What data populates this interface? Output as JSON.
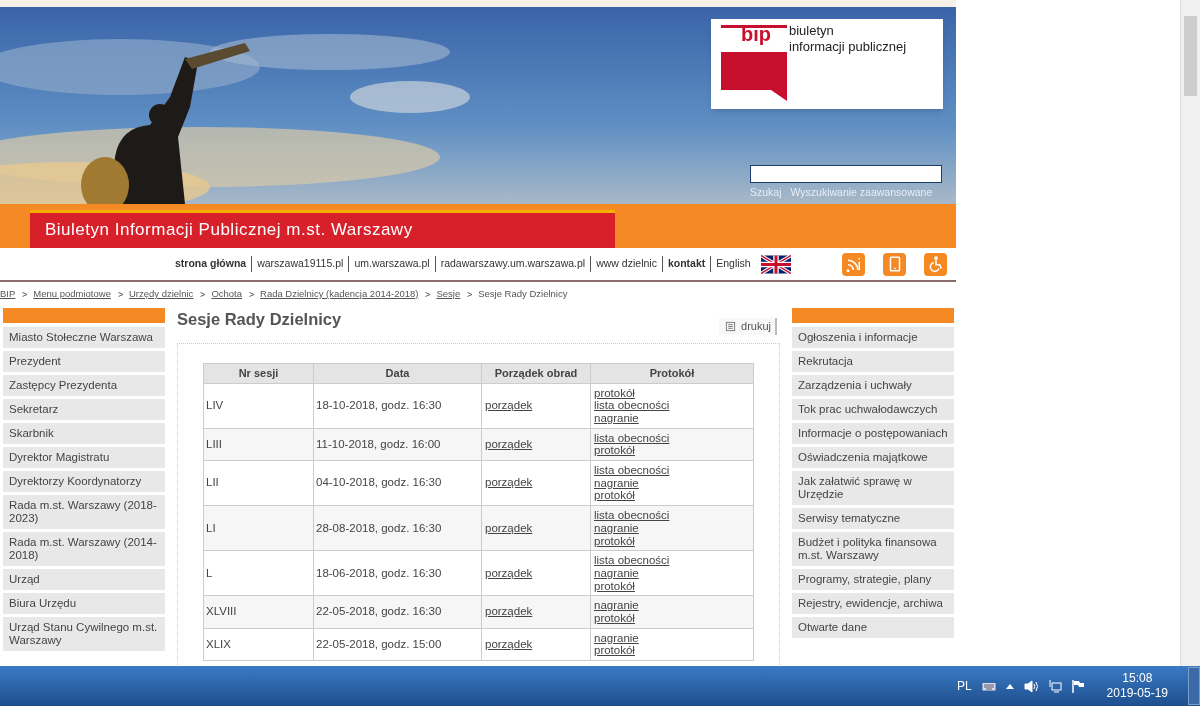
{
  "header": {
    "logo": {
      "mark": "bip",
      "line1": "biuletyn",
      "line2": "informacji publicznej"
    },
    "search": {
      "button": "Szukaj",
      "advanced": "Wyszukiwanie zaawansowane"
    },
    "title": "Biuletyn Informacji Publicznej m.st. Warszawy"
  },
  "nav": {
    "links": [
      {
        "label": "strona główna",
        "bold": true
      },
      {
        "label": "warszawa19115.pl",
        "bold": false
      },
      {
        "label": "um.warszawa.pl",
        "bold": false
      },
      {
        "label": "radawarszawy.um.warszawa.pl",
        "bold": false
      },
      {
        "label": "www dzielnic",
        "bold": false
      },
      {
        "label": "kontakt",
        "bold": true
      }
    ],
    "language": "English"
  },
  "breadcrumb": [
    {
      "label": "BIP",
      "kind": "link"
    },
    {
      "label": "Menu podmiotowe",
      "kind": "link"
    },
    {
      "label": "Urzędy dzielnic",
      "kind": "link"
    },
    {
      "label": "Ochota",
      "kind": "link"
    },
    {
      "label": "Rada Dzielnicy (kadencja 2014-2018)",
      "kind": "link"
    },
    {
      "label": "Sesje",
      "kind": "link"
    },
    {
      "label": "Sesje Rady Dzielnicy",
      "kind": "current"
    }
  ],
  "left_menu": [
    "Miasto Stołeczne Warszawa",
    "Prezydent",
    "Zastępcy Prezydenta",
    "Sekretarz",
    "Skarbnik",
    "Dyrektor Magistratu",
    "Dyrektorzy Koordynatorzy",
    "Rada m.st. Warszawy (2018-2023)",
    "Rada m.st. Warszawy (2014-2018)",
    "Urząd",
    "Biura Urzędu",
    "Urząd Stanu Cywilnego m.st. Warszawy"
  ],
  "page": {
    "title": "Sesje Rady Dzielnicy",
    "print": "drukuj"
  },
  "table": {
    "columns": [
      "Nr sesji",
      "Data",
      "Porządek obrad",
      "Protokół"
    ],
    "rows": [
      {
        "nr": "LIV",
        "date": "18-10-2018, godz. 16:30",
        "agenda": "porządek",
        "protocol": [
          "protokół",
          "lista obecności",
          "nagranie"
        ]
      },
      {
        "nr": "LIII",
        "date": "11-10-2018, godz. 16:00",
        "agenda": "porządek",
        "protocol": [
          "lista obecności",
          "protokół"
        ]
      },
      {
        "nr": "LII",
        "date": "04-10-2018, godz. 16:30",
        "agenda": "porządek",
        "protocol": [
          "lista obecności",
          "nagranie",
          "protokół"
        ]
      },
      {
        "nr": "LI",
        "date": "28-08-2018, godz. 16:30",
        "agenda": "porządek",
        "protocol": [
          "lista obecności",
          "nagranie",
          "protokół"
        ]
      },
      {
        "nr": "L",
        "date": "18-06-2018, godz. 16:30",
        "agenda": "porządek",
        "protocol": [
          "lista obecności",
          "nagranie",
          "protokół"
        ]
      },
      {
        "nr": "XLVIII",
        "date": "22-05-2018, godz. 16:30",
        "agenda": "porządek",
        "protocol": [
          "nagranie",
          "protokół"
        ]
      },
      {
        "nr": "XLIX",
        "date": "22-05-2018, godz. 15:00",
        "agenda": "porządek",
        "protocol": [
          "nagranie",
          "protokół"
        ]
      }
    ]
  },
  "right_menu": [
    "Ogłoszenia i informacje",
    "Rekrutacja",
    "Zarządzenia i uchwały",
    "Tok prac uchwałodawczych",
    "Informacje o postępowaniach",
    "Oświadczenia majątkowe",
    "Jak załatwić sprawę w Urzędzie",
    "Serwisy tematyczne",
    "Budżet i polityka finansowa m.st. Warszawy",
    "Programy, strategie, plany",
    "Rejestry, ewidencje, archiwa",
    "Otwarte dane"
  ],
  "taskbar": {
    "language": "PL",
    "time": "15:08",
    "date": "2019-05-19"
  }
}
